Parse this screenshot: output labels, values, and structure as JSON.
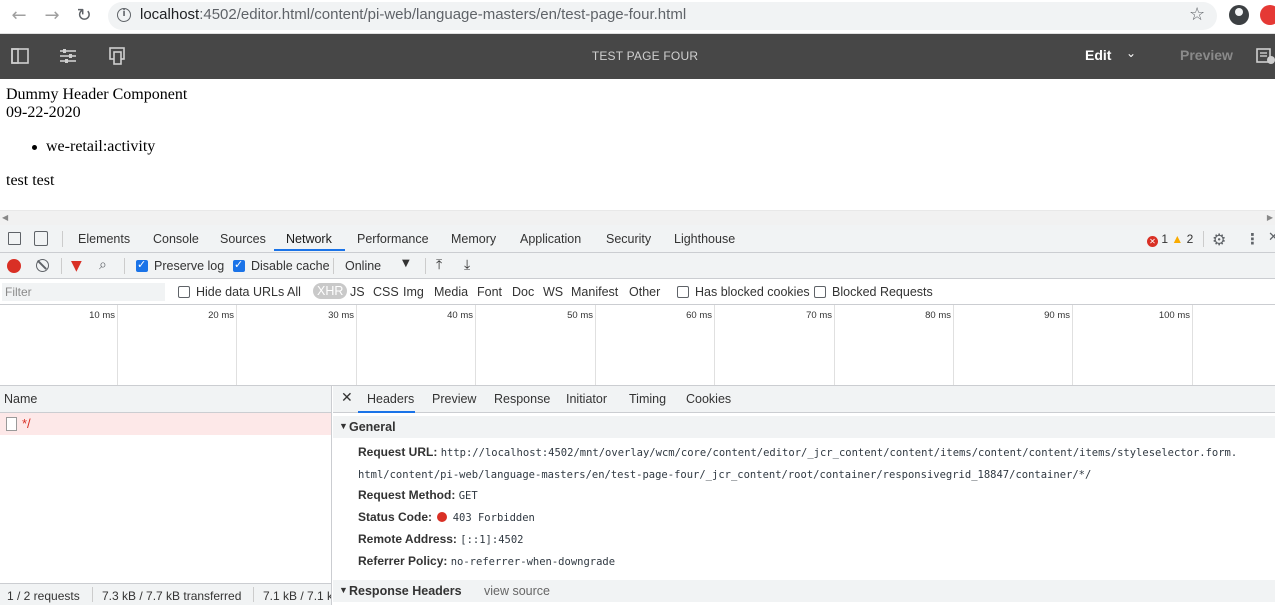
{
  "browser": {
    "url_host": "localhost",
    "url_rest": ":4502/editor.html/content/pi-web/language-masters/en/test-page-four.html"
  },
  "aem": {
    "page_title": "TEST PAGE FOUR",
    "edit_label": "Edit",
    "preview_label": "Preview"
  },
  "page": {
    "header": "Dummy Header Component",
    "date": "09-22-2020",
    "list_item": "we-retail:activity",
    "text": "test test"
  },
  "devtools": {
    "tabs": [
      "Elements",
      "Console",
      "Sources",
      "Network",
      "Performance",
      "Memory",
      "Application",
      "Security",
      "Lighthouse"
    ],
    "active_tab": "Network",
    "error_count": "1",
    "warning_count": "2",
    "toolbar": {
      "preserve_log": "Preserve log",
      "disable_cache": "Disable cache",
      "throttle": "Online"
    },
    "filter": {
      "placeholder": "Filter",
      "hide_data_urls": "Hide data URLs",
      "types": [
        "All",
        "XHR",
        "JS",
        "CSS",
        "Img",
        "Media",
        "Font",
        "Doc",
        "WS",
        "Manifest",
        "Other"
      ],
      "active_type": "XHR",
      "blocked_cookies": "Has blocked cookies",
      "blocked_requests": "Blocked Requests"
    },
    "timeline_ticks": [
      "10 ms",
      "20 ms",
      "30 ms",
      "40 ms",
      "50 ms",
      "60 ms",
      "70 ms",
      "80 ms",
      "90 ms",
      "100 ms"
    ],
    "requests": {
      "column_name": "Name",
      "rows": [
        {
          "name": "*/"
        }
      ],
      "status": {
        "count": "1 / 2 requests",
        "transferred": "7.3 kB / 7.7 kB transferred",
        "resources": "7.1 kB / 7.1 k"
      }
    },
    "detail": {
      "tabs": [
        "Headers",
        "Preview",
        "Response",
        "Initiator",
        "Timing",
        "Cookies"
      ],
      "active_tab": "Headers",
      "general_title": "General",
      "request_url_label": "Request URL:",
      "request_url_line1": "http://localhost:4502/mnt/overlay/wcm/core/content/editor/_jcr_content/content/items/content/content/items/styleselector.form.",
      "request_url_line2": "html/content/pi-web/language-masters/en/test-page-four/_jcr_content/root/container/responsivegrid_18847/container/*/",
      "method_label": "Request Method:",
      "method_value": "GET",
      "status_label": "Status Code:",
      "status_value": "403 Forbidden",
      "remote_label": "Remote Address:",
      "remote_value": "[::1]:4502",
      "referrer_label": "Referrer Policy:",
      "referrer_value": "no-referrer-when-downgrade",
      "response_headers_title": "Response Headers",
      "view_source": "view source"
    }
  }
}
